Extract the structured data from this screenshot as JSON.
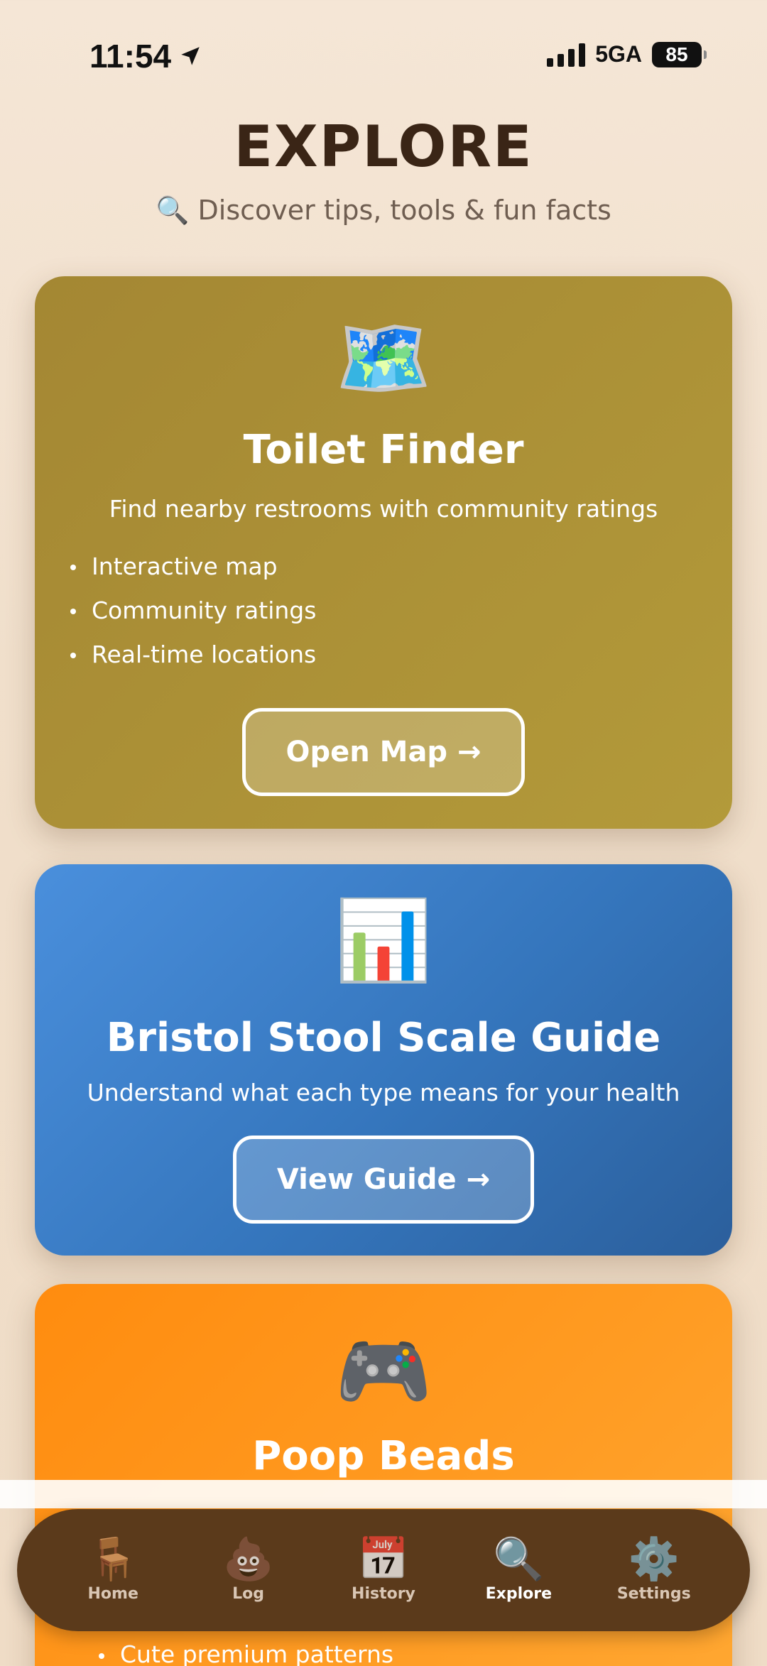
{
  "status_bar": {
    "time": "11:54",
    "network": "5GA",
    "battery": "85"
  },
  "header": {
    "title": "EXPLORE",
    "subtitle": "🔍 Discover tips, tools & fun facts"
  },
  "cards": {
    "toilet": {
      "icon": "🗺️",
      "title": "Toilet Finder",
      "description": "Find nearby restrooms with community ratings",
      "features": [
        "Interactive map",
        "Community ratings",
        "Real-time locations"
      ],
      "button": "Open Map →"
    },
    "bristol": {
      "icon": "📊",
      "title": "Bristol Stool Scale Guide",
      "description": "Understand what each type means for your health",
      "button": "View Guide →"
    },
    "beads": {
      "icon": "🎮",
      "title": "Poop Beads",
      "features": [
        "Cute premium patterns"
      ]
    }
  },
  "tab_bar": {
    "tabs": [
      {
        "label": "Home",
        "icon": "🪑"
      },
      {
        "label": "Log",
        "icon": "💩"
      },
      {
        "label": "History",
        "icon": "📅"
      },
      {
        "label": "Explore",
        "icon": "🔍"
      },
      {
        "label": "Settings",
        "icon": "⚙️"
      }
    ],
    "active": "Explore"
  },
  "colors": {
    "toilet_card": "#a48733",
    "bristol_card": "#3576bd",
    "beads_card": "#ff9c23",
    "tab_bar": "#5b3a1b"
  }
}
